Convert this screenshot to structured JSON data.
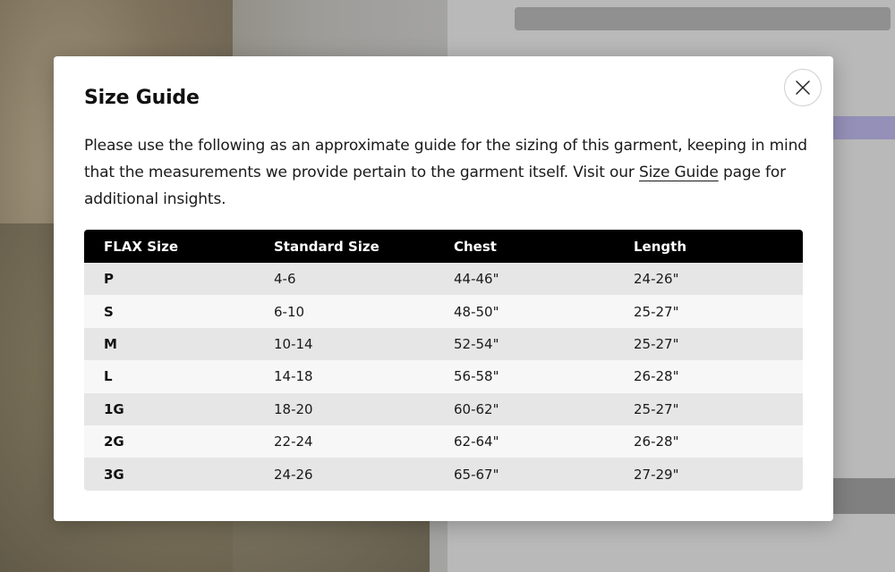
{
  "modal": {
    "title": "Size Guide",
    "description_before": "Please use the following as an approximate guide for the sizing of this garment, keeping in mind that the measurements we provide pertain to the garment itself. Visit our ",
    "description_link": "Size Guide",
    "description_after": " page for additional insights.",
    "close_icon": "close-icon"
  },
  "table": {
    "headers": [
      "FLAX Size",
      "Standard Size",
      "Chest",
      "Length"
    ],
    "rows": [
      [
        "P",
        "4-6",
        "44-46\"",
        "24-26\""
      ],
      [
        "S",
        "6-10",
        "48-50\"",
        "25-27\""
      ],
      [
        "M",
        "10-14",
        "52-54\"",
        "25-27\""
      ],
      [
        "L",
        "14-18",
        "56-58\"",
        "26-28\""
      ],
      [
        "1G",
        "18-20",
        "60-62\"",
        "25-27\""
      ],
      [
        "2G",
        "22-24",
        "62-64\"",
        "26-28\""
      ],
      [
        "3G",
        "24-26",
        "65-67\"",
        "27-29\""
      ]
    ]
  },
  "colors": {
    "header_bg": "#000000",
    "row_odd_bg": "#e6e6e6",
    "row_even_bg": "#f7f7f7",
    "overlay": "#a6a6a6"
  }
}
